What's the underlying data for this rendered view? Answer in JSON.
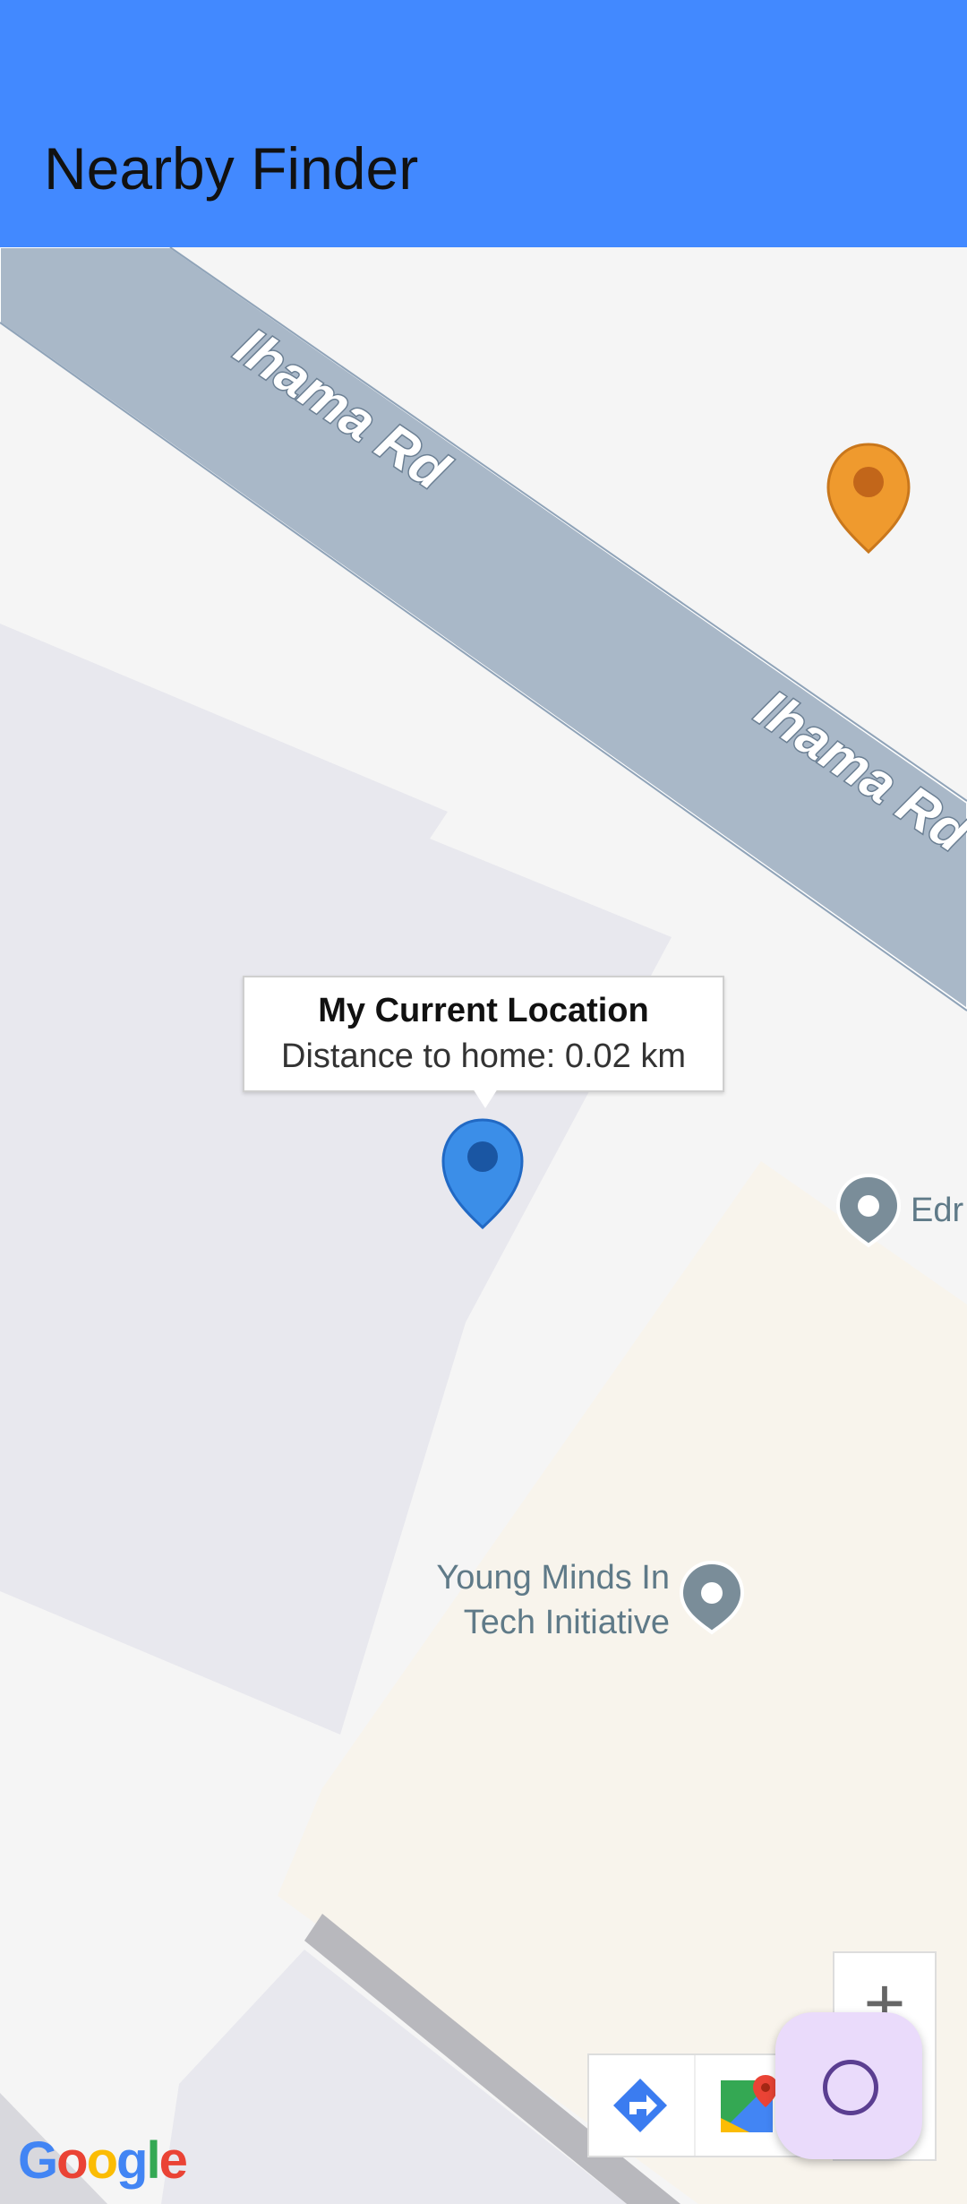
{
  "app": {
    "title": "Nearby Finder"
  },
  "map": {
    "road_labels": [
      "Ihama Rd",
      "Ihama Rd"
    ],
    "info_window": {
      "title": "My Current Location",
      "subtitle": "Distance to home: 0.02 km"
    },
    "pois": [
      {
        "label": "Edr"
      },
      {
        "label_line1": "Young Minds In",
        "label_line2": "Tech Initiative"
      }
    ],
    "markers": [
      {
        "icon": "orange-map-pin-icon",
        "color": "#ef9a2e"
      },
      {
        "icon": "blue-map-pin-icon",
        "color": "#3b8ee8"
      }
    ],
    "controls": {
      "zoom_in": "+",
      "directions_icon": "directions-icon",
      "maps_icon": "google-maps-icon"
    },
    "attribution": "Google"
  },
  "fab": {
    "icon": "circle-icon"
  },
  "colors": {
    "appbar": "#4289ff",
    "road": "#a9b8c8",
    "poi": "#7a8d99",
    "building": "#e9e9ee",
    "park": "#f8f4ec",
    "fab": "#eadbfb"
  }
}
